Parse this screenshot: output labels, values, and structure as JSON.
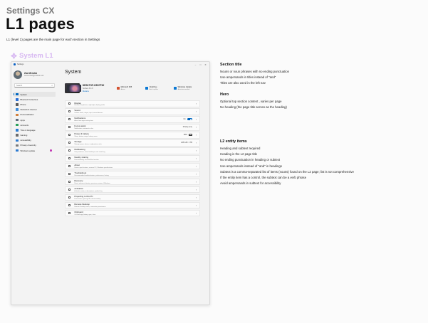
{
  "header": {
    "eyebrow": "Settings CX",
    "title": "L1 pages",
    "lead": "L1 (level 1) pages are the main page for each section in Settings"
  },
  "tag": {
    "label": "System L1",
    "color": "#d8b9f2"
  },
  "window": {
    "title": "Settings",
    "controls": [
      "–",
      "□",
      "✕"
    ],
    "profile": {
      "name": "Zac Mendez",
      "email": "zacmendez@outlook.com"
    },
    "search_placeholder": "Search",
    "nav": [
      {
        "label": "System",
        "icon": "system-icon",
        "color": "#0067c0",
        "active": true
      },
      {
        "label": "Bluetooth & devices",
        "icon": "bluetooth-icon",
        "color": "#2b6fd6"
      },
      {
        "label": "Phone",
        "icon": "phone-icon",
        "color": "#5a5a5a"
      },
      {
        "label": "Network & internet",
        "icon": "network-icon",
        "color": "#3e8ede"
      },
      {
        "label": "Personalization",
        "icon": "brush-icon",
        "color": "#d1803c"
      },
      {
        "label": "Apps",
        "icon": "apps-icon",
        "color": "#5f6b7a"
      },
      {
        "label": "Accounts",
        "icon": "accounts-icon",
        "color": "#2aa05a"
      },
      {
        "label": "Time & language",
        "icon": "clock-icon",
        "color": "#2b7cd3"
      },
      {
        "label": "Gaming",
        "icon": "gaming-icon",
        "color": "#6b6b6b"
      },
      {
        "label": "Accessibility",
        "icon": "accessibility-icon",
        "color": "#2d7bd1"
      },
      {
        "label": "Privacy & security",
        "icon": "shield-icon",
        "color": "#7a7a7a"
      },
      {
        "label": "Windows update",
        "icon": "update-icon",
        "color": "#2d7bd1",
        "badge": true
      }
    ],
    "page_title": "System",
    "hero": {
      "device_name": "DESKTOP-H5G7P8J",
      "device_model": "Surface Pro 8",
      "rename": "Rename",
      "stats": [
        {
          "title": "Microsoft 365",
          "sub": "Active",
          "color": "#d35230",
          "icon": "m365-icon"
        },
        {
          "title": "OneDrive",
          "sub": "Back up files",
          "color": "#0a78d4",
          "icon": "onedrive-icon"
        },
        {
          "title": "Windows Update",
          "sub": "Attention needed",
          "color": "#0a78d4",
          "icon": "update-icon"
        }
      ]
    },
    "rows": [
      {
        "title": "Display",
        "sub": "Monitors, brightness, night light, display profile",
        "icon": "display-icon"
      },
      {
        "title": "Sound",
        "sub": "Volume levels, output, input, sound devices",
        "icon": "sound-icon"
      },
      {
        "title": "Notifications",
        "sub": "Alerts from apps and system",
        "icon": "bell-icon",
        "value": "On",
        "control": "toggle"
      },
      {
        "title": "Focus assist",
        "sub": "Notifications, automatic rules",
        "icon": "moon-icon",
        "value": "Priority only"
      },
      {
        "title": "Power & battery",
        "sub": "Sleep, battery usage, battery saver",
        "icon": "power-icon",
        "value": "89%",
        "control": "battery"
      },
      {
        "title": "Storage",
        "sub": "Storage space, drives, configuration rules",
        "icon": "storage-icon",
        "value": "245 GB / 1 TB"
      },
      {
        "title": "Multitasking",
        "sub": "Snap windows, virtual desktops, task switching",
        "icon": "multitask-icon"
      },
      {
        "title": "Nearby sharing",
        "sub": "Discoverability, received files location",
        "icon": "share-icon"
      },
      {
        "title": "About",
        "sub": "Device specifications, rename PC, Windows specifications",
        "icon": "info-icon"
      },
      {
        "title": "Troubleshoot",
        "sub": "Recommended troubleshooters, preferences, history",
        "icon": "wrench-icon"
      },
      {
        "title": "Recovery",
        "sub": "Reset, advanced startup, previous version of Windows",
        "icon": "recovery-icon"
      },
      {
        "title": "Activation",
        "sub": "Activation state, subscriptions, product key",
        "icon": "key-icon"
      },
      {
        "title": "Projecting to this PC",
        "sub": "Permissions, pairing PIN, discoverability",
        "icon": "project-icon"
      },
      {
        "title": "Remote Desktop",
        "sub": "Remote Desktop users, connection permissions",
        "icon": "remote-icon"
      },
      {
        "title": "Clipboard",
        "sub": "Cut and copy history, sync, clear",
        "icon": "clipboard-icon"
      }
    ]
  },
  "annotations": [
    {
      "heading": "Section title",
      "lines": [
        "Nouns or noun phrases with no ending punctuation",
        "Use ampersands in titles instead of \"and\"",
        "Titles are also used in the left nav"
      ]
    },
    {
      "heading": "Hero",
      "lines": [
        "Optional top section content , varies per page",
        "No heading (the page title serves as the heading)"
      ]
    },
    {
      "heading": "L2 entity items",
      "lines": [
        "Heading and subtext required",
        "Heading is the L2 page title",
        "No ending punctuation in heading or subtext",
        "Use ampersands instead of \"and\" in headings",
        "Subtext is a comma-separated list of items (nouns) found on the L2 page; list is not comprehensive",
        "If the entity item has a control, the subtext can be a verb phrase",
        "Avoid ampersands in subtext for accessibility"
      ]
    }
  ]
}
